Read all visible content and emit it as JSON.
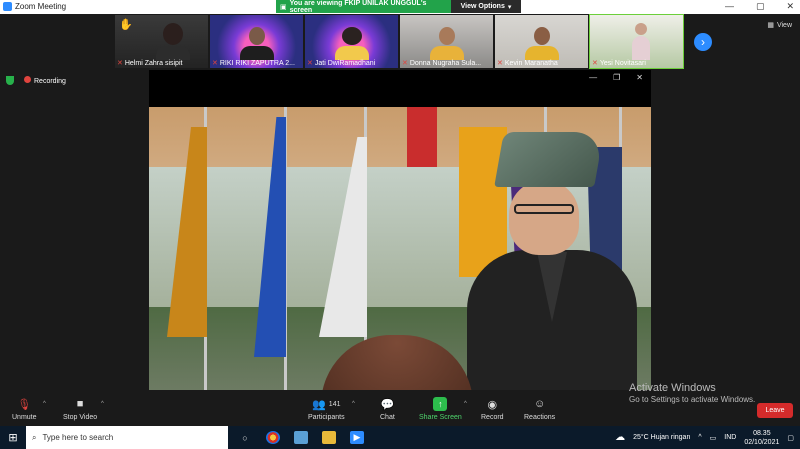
{
  "window": {
    "title": "Zoom Meeting"
  },
  "share_banner": {
    "message": "You are viewing FKIP UNILAK UNGGUL's screen",
    "options_label": "View Options"
  },
  "thumbnails": [
    {
      "name": "Helmi Zahra sisipit",
      "icon": "raised-hand-icon"
    },
    {
      "name": "RIKI RIKI ZAPUTRA 2..."
    },
    {
      "name": "Jati DwiRamadhani"
    },
    {
      "name": "Donna Nugraha Sula..."
    },
    {
      "name": "Kevin Maranatha"
    },
    {
      "name": "Yesi Novitasari"
    }
  ],
  "view_label": "View",
  "status": {
    "recording_label": "Recording"
  },
  "toolbar": {
    "unmute": "Unmute",
    "stop_video": "Stop Video",
    "participants": "Participants",
    "participant_count": "141",
    "chat": "Chat",
    "share_screen": "Share Screen",
    "record": "Record",
    "reactions": "Reactions",
    "leave": "Leave"
  },
  "activation": {
    "title": "Activate Windows",
    "subtitle": "Go to Settings to activate Windows."
  },
  "taskbar": {
    "search_placeholder": "Type here to search",
    "weather": "25°C  Hujan ringan",
    "language": "IND",
    "time": "08.35",
    "date": "02/10/2021"
  },
  "colors": {
    "accent": "#2d8cff",
    "share_green": "#22a34a",
    "leave_red": "#d52b2b"
  }
}
